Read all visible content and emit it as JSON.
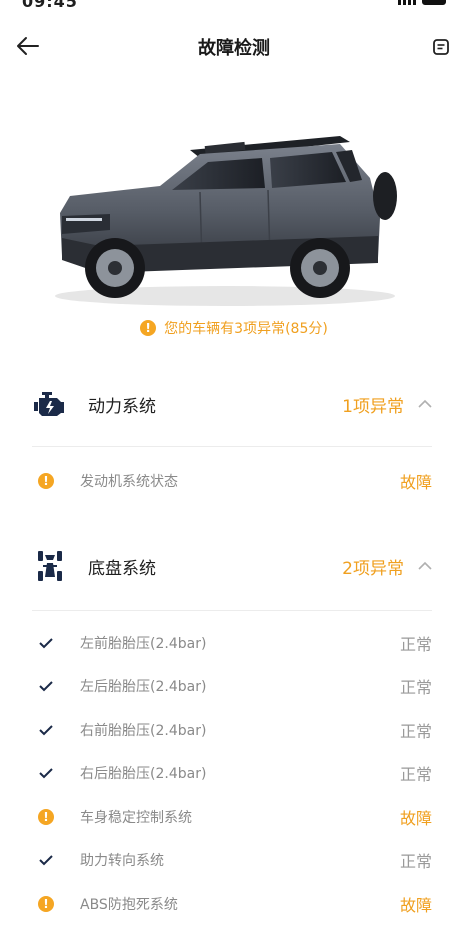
{
  "status_bar": {
    "time": "09:45"
  },
  "nav": {
    "title": "故障检测"
  },
  "summary": {
    "text": "您的车辆有3项异常(85分)"
  },
  "sections": [
    {
      "name": "动力系统",
      "count": "1项异常",
      "items": [
        {
          "label": "发动机系统状态",
          "state": "故障",
          "status": "fault"
        }
      ]
    },
    {
      "name": "底盘系统",
      "count": "2项异常",
      "items": [
        {
          "label": "左前胎胎压(2.4bar)",
          "state": "正常",
          "status": "ok"
        },
        {
          "label": "左后胎胎压(2.4bar)",
          "state": "正常",
          "status": "ok"
        },
        {
          "label": "右前胎胎压(2.4bar)",
          "state": "正常",
          "status": "ok"
        },
        {
          "label": "右后胎胎压(2.4bar)",
          "state": "正常",
          "status": "ok"
        },
        {
          "label": "车身稳定控制系统",
          "state": "故障",
          "status": "fault"
        },
        {
          "label": "助力转向系统",
          "state": "正常",
          "status": "ok"
        },
        {
          "label": "ABS防抱死系统",
          "state": "故障",
          "status": "fault"
        }
      ]
    }
  ],
  "colors": {
    "accent": "#f0a020",
    "warn_icon": "#f5a623",
    "ok_check": "#1b2a48"
  },
  "icons": [
    "back-arrow-icon",
    "memo-icon",
    "warning-icon",
    "engine-icon",
    "chassis-icon",
    "chevron-up-icon",
    "check-icon"
  ]
}
